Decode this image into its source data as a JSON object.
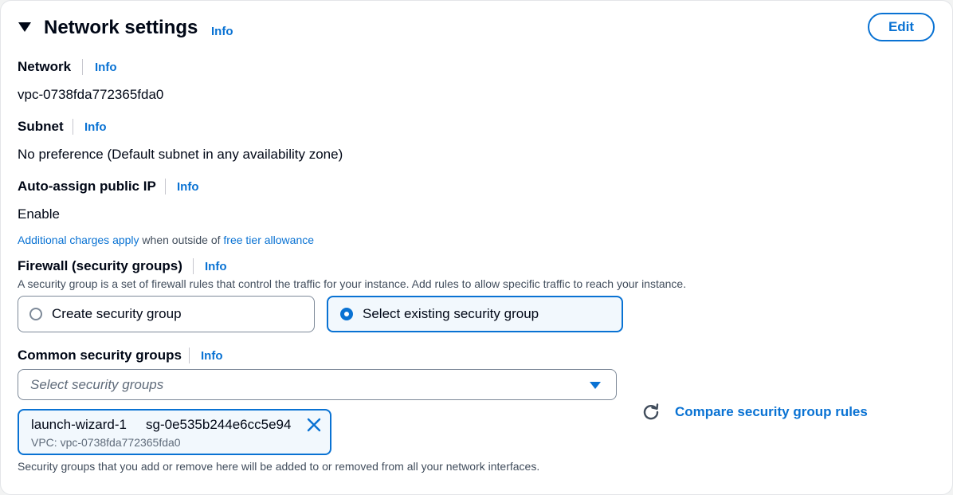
{
  "section": {
    "title": "Network settings",
    "info": "Info",
    "edit_label": "Edit"
  },
  "network": {
    "label": "Network",
    "info": "Info",
    "value": "vpc-0738fda772365fda0"
  },
  "subnet": {
    "label": "Subnet",
    "info": "Info",
    "value": "No preference (Default subnet in any availability zone)"
  },
  "auto_ip": {
    "label": "Auto-assign public IP",
    "info": "Info",
    "value": "Enable"
  },
  "charges": {
    "link1": "Additional charges apply",
    "middle": " when outside of ",
    "link2": "free tier allowance"
  },
  "firewall": {
    "label": "Firewall (security groups)",
    "info": "Info",
    "description": "A security group is a set of firewall rules that control the traffic for your instance. Add rules to allow specific traffic to reach your instance.",
    "options": [
      {
        "label": "Create security group",
        "selected": false
      },
      {
        "label": "Select existing security group",
        "selected": true
      }
    ]
  },
  "common_groups": {
    "label": "Common security groups",
    "info": "Info",
    "placeholder": "Select security groups",
    "token": {
      "name": "launch-wizard-1",
      "id": "sg-0e535b244e6cc5e94",
      "vpc": "VPC: vpc-0738fda772365fda0"
    },
    "compare_label": "Compare security group rules",
    "footer": "Security groups that you add or remove here will be added to or removed from all your network interfaces."
  },
  "colors": {
    "accent": "#0972d3",
    "text": "#000716",
    "muted": "#5f6b7a"
  },
  "icons": [
    "caret-down-icon",
    "dropdown-arrow-icon",
    "remove-x-icon",
    "refresh-icon"
  ]
}
